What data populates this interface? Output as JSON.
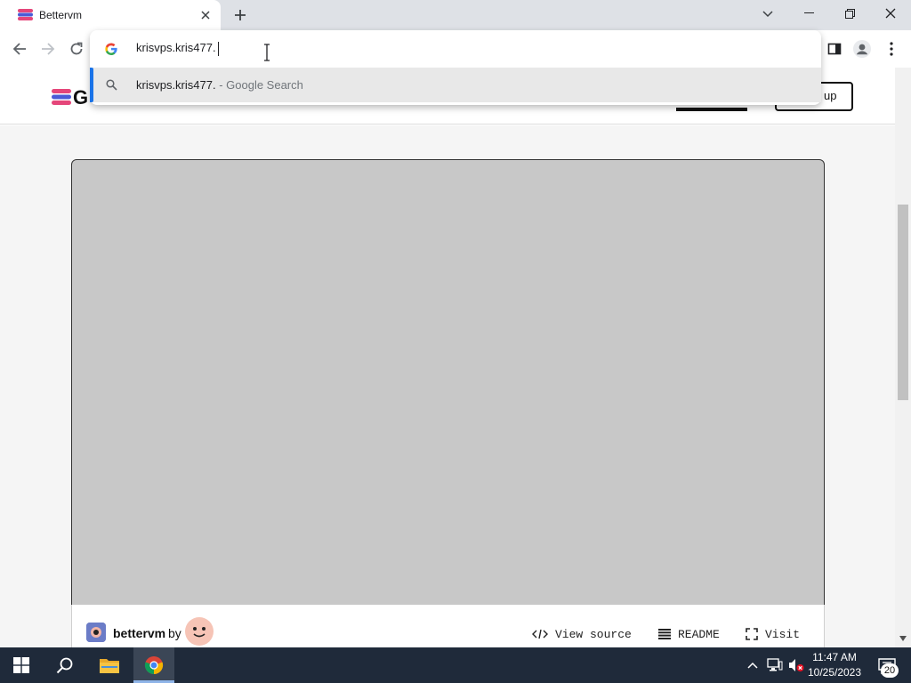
{
  "browser": {
    "tab": {
      "title": "Bettervm",
      "close": "×"
    },
    "new_tab": "+",
    "omnibox": {
      "input_value": "krisvps.kris477.",
      "suggestion": {
        "query": "krisvps.kris477.",
        "hint": "- Google Search"
      }
    }
  },
  "page": {
    "header": {
      "logo_letter": "G",
      "signup_label": "up"
    },
    "app": {
      "name": "bettervm",
      "by": "by",
      "links": {
        "view_source": "View source",
        "readme": "README",
        "visit": "Visit"
      }
    }
  },
  "taskbar": {
    "time": "11:47 AM",
    "date": "10/25/2023",
    "notification_count": "20"
  },
  "colors": {
    "accent": "#1a73e8",
    "app_frame": "#c8c8c8",
    "taskbar": "#1f2a3a"
  },
  "icons": [
    "back-icon",
    "forward-icon",
    "reload-icon",
    "google-g-icon",
    "search-icon",
    "side-panel-icon",
    "profile-icon",
    "menu-icon",
    "windows-start-icon",
    "file-explorer-icon",
    "chrome-icon"
  ]
}
